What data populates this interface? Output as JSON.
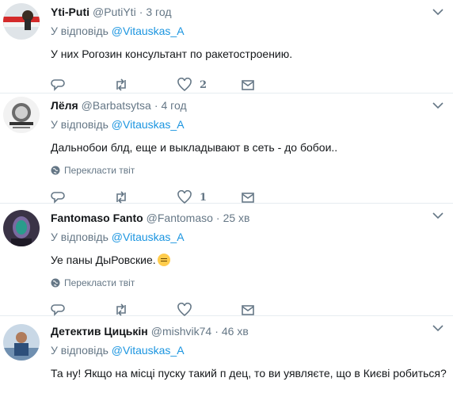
{
  "tweets": [
    {
      "name": "Yti-Puti",
      "handle": "@PutiYti",
      "dot": "·",
      "time": "3 год",
      "reply_prefix": "У відповідь",
      "reply_to": "@Vitauskas_A",
      "text": "У них Рогозин консультант по ракетостроению.",
      "likes": "2"
    },
    {
      "name": "Лёля",
      "handle": "@Barbatsytsa",
      "dot": "·",
      "time": "4 год",
      "reply_prefix": "У відповідь",
      "reply_to": "@Vitauskas_A",
      "text": "Дальнобои блд, еще и выкладывают в сеть - до  бобои..",
      "translate": "Перекласти твіт",
      "likes": "1"
    },
    {
      "name": "Fantomaso Fanto",
      "handle": "@Fantomaso",
      "dot": "·",
      "time": "25 хв",
      "reply_prefix": "У відповідь",
      "reply_to": "@Vitauskas_A",
      "text": "Уе  паны ДыРовские.",
      "translate": "Перекласти твіт"
    },
    {
      "name": "Детектив Цицькін",
      "handle": "@mishvik74",
      "dot": "·",
      "time": "46 хв",
      "reply_prefix": "У відповідь",
      "reply_to": "@Vitauskas_A",
      "text": "Та ну! Якщо на місці пуску такий п   дец, то ви уявляєте, що в Києві робиться?"
    }
  ],
  "icons": {
    "reply": "reply-icon",
    "retweet": "retweet-icon",
    "like": "heart-icon",
    "dm": "envelope-icon",
    "caret": "chevron-down-icon",
    "globe": "globe-icon"
  },
  "colors": {
    "link": "#1b95e0",
    "muted": "#657786",
    "text": "#14171a",
    "divider": "#e6ecf0"
  }
}
